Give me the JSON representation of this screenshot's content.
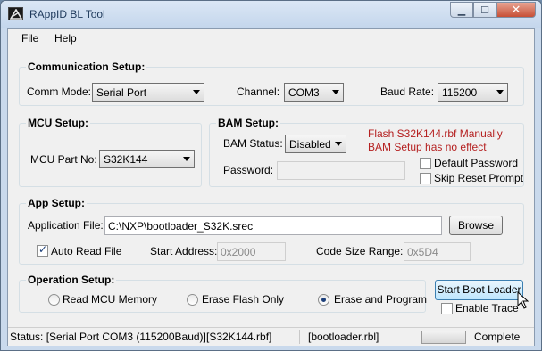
{
  "window": {
    "title": "RAppID BL Tool",
    "min_symbol": "▁",
    "max_symbol": "☐",
    "close_symbol": "✕"
  },
  "menu": {
    "file": "File",
    "help": "Help"
  },
  "communication": {
    "title": "Communication Setup:",
    "comm_mode_label": "Comm Mode:",
    "comm_mode_value": "Serial Port",
    "channel_label": "Channel:",
    "channel_value": "COM3",
    "baud_label": "Baud Rate:",
    "baud_value": "115200"
  },
  "mcu": {
    "title": "MCU Setup:",
    "part_label": "MCU Part No:",
    "part_value": "S32K144"
  },
  "bam": {
    "title": "BAM Setup:",
    "status_label": "BAM Status:",
    "status_value": "Disabled",
    "password_label": "Password:",
    "password_value": "",
    "note_line1": "Flash S32K144.rbf Manually",
    "note_line2": "BAM Setup has no effect",
    "default_password_label": "Default Password",
    "skip_reset_label": "Skip Reset Prompt"
  },
  "app": {
    "title": "App Setup:",
    "file_label": "Application File:",
    "file_value": "C:\\NXP\\bootloader_S32K.srec",
    "browse_label": "Browse",
    "auto_read_label": "Auto Read File",
    "start_address_label": "Start Address:",
    "start_address_value": "0x2000",
    "code_size_label": "Code Size Range:",
    "code_size_value": "0x5D4"
  },
  "operation": {
    "title": "Operation Setup:",
    "read_mcu_label": "Read MCU Memory",
    "erase_flash_label": "Erase Flash Only",
    "erase_program_label": "Erase and Program",
    "start_button_label": "Start Boot Loader",
    "enable_trace_label": "Enable Trace",
    "selected": "erase_program"
  },
  "status": {
    "connection": "Status: [Serial Port COM3 (115200Baud)]",
    "rbf": "[S32K144.rbf]",
    "rbl": "[bootloader.rbl]",
    "state": "Complete"
  },
  "icons": {
    "app": "app-logo-icon",
    "cursor": "mouse-pointer-icon"
  },
  "colors": {
    "note_red": "#b52121",
    "titlebar": "#c4d6ec",
    "button_hot": "#bee6fd"
  }
}
